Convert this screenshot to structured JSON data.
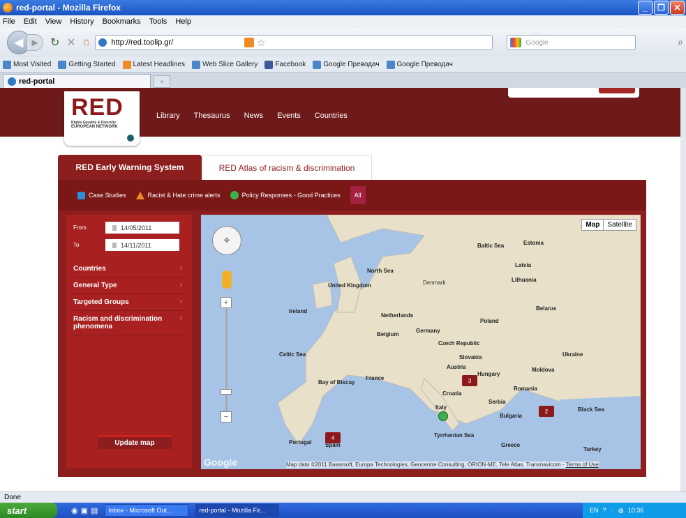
{
  "window": {
    "title": "red-portal - Mozilla Firefox"
  },
  "menu": [
    "File",
    "Edit",
    "View",
    "History",
    "Bookmarks",
    "Tools",
    "Help"
  ],
  "nav": {
    "url": "http://red.toolip.gr/",
    "search_placeholder": "Google"
  },
  "bookmarks": [
    "Most Visited",
    "Getting Started",
    "Latest Headlines",
    "Web Slice Gallery",
    "Facebook",
    "Google Преводач",
    "Google Преводач"
  ],
  "tab": {
    "label": "red-portal",
    "new_tab": "+"
  },
  "site": {
    "logo": {
      "big": "RED",
      "small": "Rights Equality & Diversity",
      "net": "EUROPEAN NETWORK"
    },
    "topnav": [
      "Library",
      "Thesaurus",
      "News",
      "Events",
      "Countries"
    ],
    "tabs": {
      "ews": "RED Early Warning System",
      "atlas": "RED Atlas of racism & discrimination"
    },
    "legend": {
      "case": "Case Studies",
      "alerts": "Racist & Hate crime alerts",
      "policy": "Policy Responses - Good Practices",
      "all": "All"
    },
    "filters": {
      "from_label": "From",
      "from_value": "14/05/2011",
      "to_label": "To",
      "to_value": "14/11/2011",
      "items": [
        "Countries",
        "General Type",
        "Targeted Groups",
        "Racism and discrimination phenomena"
      ],
      "update": "Update map"
    },
    "map": {
      "map_btn": "Map",
      "sat_btn": "Satellite",
      "markers": [
        "3",
        "2",
        "4"
      ],
      "labels": [
        "North Sea",
        "United Kingdom",
        "Ireland",
        "Denmark",
        "Lithuania",
        "Belarus",
        "Netherlands",
        "Belgium",
        "Germany",
        "Poland",
        "Czech Republic",
        "Slovakia",
        "Austria",
        "Hungary",
        "Ukraine",
        "Moldova",
        "France",
        "Croatia",
        "Serbia",
        "Romania",
        "Bulgaria",
        "Black Sea",
        "Italy",
        "Spain",
        "Portugal",
        "Greece",
        "Turkey",
        "Estonia",
        "Latvia",
        "Baltic Sea",
        "Celtic Sea",
        "Bay of Biscay",
        "Tyrrhenian Sea"
      ],
      "attribution": "Map data ©2011 Basarsoft, Europa Technologies, Geocentre Consulting, ORION-ME, Tele Atlas, Transnavicom",
      "terms": "Terms of Use",
      "google": "Google"
    }
  },
  "status": "Done",
  "taskbar": {
    "start": "start",
    "tasks": [
      "Inbox - Microsoft Out...",
      "red-portal - Mozilla Fir..."
    ],
    "tray_lang": "EN",
    "clock": "10:36"
  }
}
